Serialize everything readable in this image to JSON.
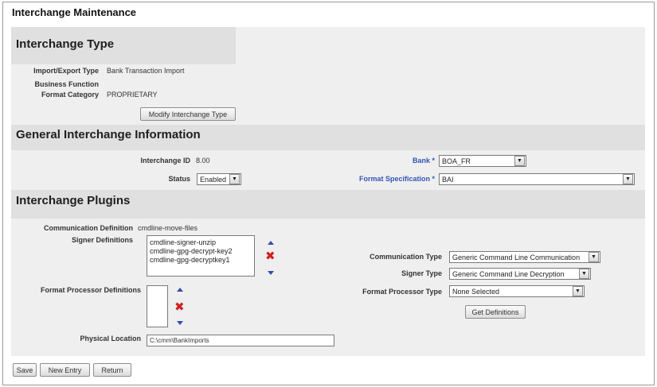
{
  "page": {
    "title": "Interchange Maintenance"
  },
  "interchange_type": {
    "title": "Interchange Type",
    "import_export_label": "Import/Export Type",
    "import_export_value": "Bank Transaction Import",
    "business_function_label": "Business Function",
    "format_category_label": "Format Category",
    "format_category_value": "PROPRIETARY",
    "modify_button": "Modify Interchange Type"
  },
  "general": {
    "title": "General Interchange Information",
    "interchange_id_label": "Interchange ID",
    "interchange_id_value": "8.00",
    "status_label": "Status",
    "status_value": "Enabled",
    "bank_label": "Bank *",
    "bank_value": "BOA_FR",
    "format_spec_label": "Format Specification *",
    "format_spec_value": "BAI"
  },
  "plugins": {
    "title": "Interchange Plugins",
    "comm_def_label": "Communication Definition",
    "comm_def_value": "cmdline-move-files",
    "signer_defs_label": "Signer Definitions",
    "signer_defs": [
      "cmdline-signer-unzip",
      "cmdline-gpg-decrypt-key2",
      "cmdline-gpg-decryptkey1"
    ],
    "format_proc_defs_label": "Format Processor Definitions",
    "physical_location_label": "Physical Location",
    "physical_location_value": "C:\\cmm\\BankImports",
    "comm_type_label": "Communication Type",
    "comm_type_value": "Generic Command Line Communication",
    "signer_type_label": "Signer Type",
    "signer_type_value": "Generic Command Line Decryption",
    "format_proc_type_label": "Format Processor Type",
    "format_proc_type_value": "None Selected",
    "get_definitions_button": "Get Definitions"
  },
  "footer": {
    "save": "Save",
    "new_entry": "New Entry",
    "return": "Return"
  },
  "icons": {
    "move_up": "arrow-up-icon",
    "move_down": "arrow-down-icon",
    "remove": "remove-x-icon"
  },
  "colors": {
    "link_blue": "#3354b8",
    "remove_red": "#d21e1e",
    "band_gray": "#e0e0e0",
    "panel_gray": "#efefef"
  }
}
